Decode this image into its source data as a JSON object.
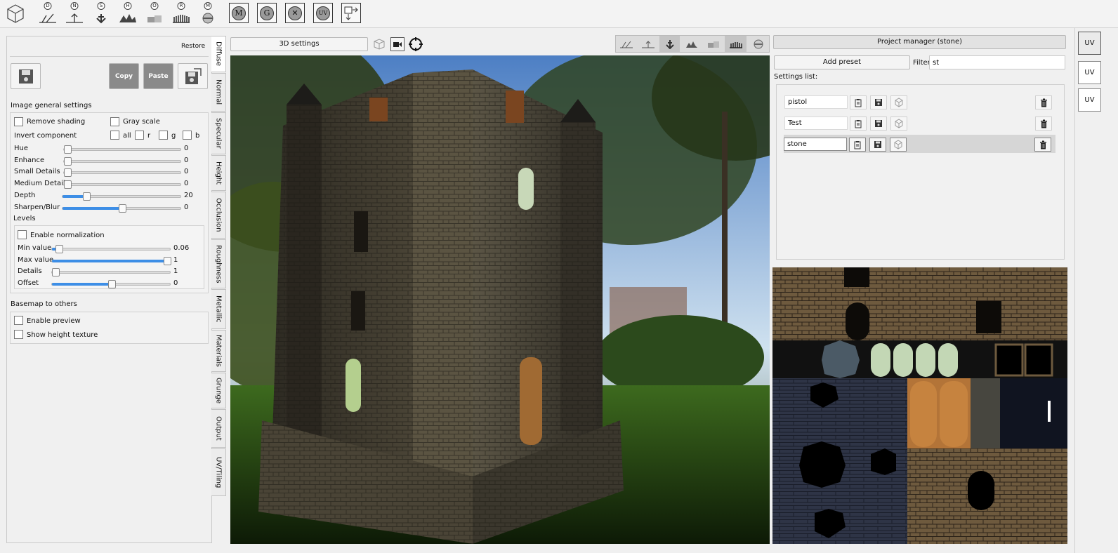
{
  "toolbar": {
    "map_buttons": [
      {
        "letter": "D",
        "name": "diffuse-map-icon"
      },
      {
        "letter": "N",
        "name": "normal-map-icon"
      },
      {
        "letter": "S",
        "name": "specular-map-icon"
      },
      {
        "letter": "H",
        "name": "height-map-icon"
      },
      {
        "letter": "O",
        "name": "occlusion-map-icon"
      },
      {
        "letter": "R",
        "name": "roughness-map-icon"
      },
      {
        "letter": "M",
        "name": "metallic-map-icon"
      }
    ],
    "mode_buttons": [
      "M",
      "G",
      "",
      "UV"
    ]
  },
  "left_panel": {
    "restore_label": "Restore",
    "copy_label": "Copy",
    "paste_label": "Paste",
    "general_title": "Image general settings",
    "remove_shading_label": "Remove shading",
    "gray_scale_label": "Gray scale",
    "invert_label": "Invert component",
    "invert_options": [
      "all",
      "r",
      "g",
      "b"
    ],
    "sliders": [
      {
        "label": "Hue",
        "value": "0",
        "fraction": 0.0
      },
      {
        "label": "Enhance",
        "value": "0",
        "fraction": 0.0
      },
      {
        "label": "Small Details",
        "value": "0",
        "fraction": 0.0
      },
      {
        "label": "Medium Details",
        "value": "0",
        "fraction": 0.0
      },
      {
        "label": "Depth",
        "value": "20",
        "fraction": 0.2
      },
      {
        "label": "Sharpen/Blur",
        "value": "0",
        "fraction": 0.5
      }
    ],
    "levels_title": "Levels",
    "enable_normalization_label": "Enable normalization",
    "level_sliders": [
      {
        "label": "Min value",
        "value": "0.06",
        "fraction": 0.06
      },
      {
        "label": "Max value",
        "value": "1",
        "fraction": 1.0
      },
      {
        "label": "Details",
        "value": "1",
        "fraction": 0.0
      },
      {
        "label": "Offset",
        "value": "0",
        "fraction": 0.5
      }
    ],
    "basemap_title": "Basemap to others",
    "enable_preview_label": "Enable preview",
    "show_height_label": "Show height texture"
  },
  "tabs": [
    "Diffuse",
    "Normal",
    "Specular",
    "Height",
    "Occlusion",
    "Roughness",
    "Metallic",
    "Materials",
    "Grunge",
    "Output",
    "UV/Tiling"
  ],
  "viewport": {
    "settings_label": "3D settings"
  },
  "project": {
    "title": "Project manager (stone)",
    "add_preset_label": "Add preset",
    "filter_label": "Filter",
    "filter_value": "st",
    "settings_list_label": "Settings list:",
    "presets": [
      "pistol",
      "Test",
      "stone"
    ],
    "selected": "stone"
  },
  "uv_buttons": [
    "UV",
    "UV",
    "UV"
  ],
  "colors": {
    "accent": "#3d8ee6",
    "selected_row": "#d6d6d6"
  }
}
